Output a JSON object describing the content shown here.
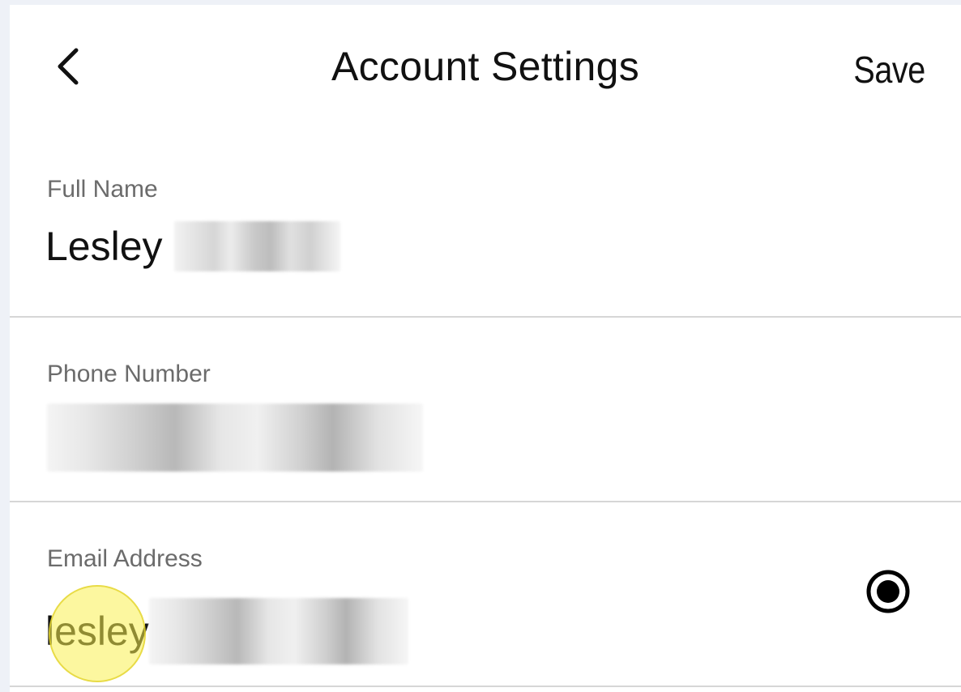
{
  "header": {
    "title": "Account Settings",
    "save_label": "Save",
    "back_icon": "chevron-left-icon"
  },
  "fields": [
    {
      "label": "Full Name",
      "value_visible": "Lesley",
      "value_redacted": true
    },
    {
      "label": "Phone Number",
      "value_visible": "",
      "value_redacted": true
    },
    {
      "label": "Email Address",
      "value_visible": "lesley",
      "value_redacted": true
    }
  ],
  "email_radio": {
    "icon": "radio-selected-icon",
    "selected": true
  },
  "colors": {
    "text": "#111111",
    "label": "#6b6b6b",
    "divider": "#d6d6d6",
    "background_outer": "#eef1f7",
    "highlight": "#f5eb50"
  }
}
